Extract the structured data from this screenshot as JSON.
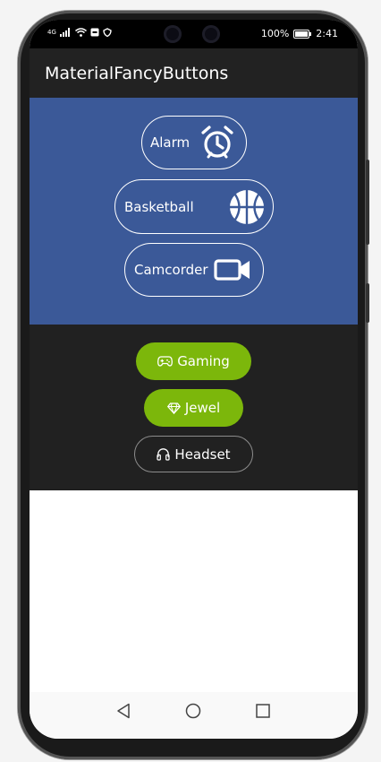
{
  "status_bar": {
    "signal_text": "4G",
    "battery": "100%",
    "time": "2:41"
  },
  "app_bar": {
    "title": "MaterialFancyButtons"
  },
  "fancy_buttons": [
    {
      "label": "Alarm",
      "icon": "alarm-clock-icon"
    },
    {
      "label": "Basketball",
      "icon": "basketball-icon"
    },
    {
      "label": "Camcorder",
      "icon": "video-camera-icon"
    }
  ],
  "pill_buttons": [
    {
      "label": "Gaming",
      "icon": "gamepad-icon",
      "style": "filled",
      "color": "#7cb70b"
    },
    {
      "label": "Jewel",
      "icon": "diamond-icon",
      "style": "filled",
      "color": "#7cb70b"
    },
    {
      "label": "Headset",
      "icon": "headphones-icon",
      "style": "outlined",
      "color": "#212121"
    }
  ],
  "colors": {
    "app_bar": "#222222",
    "blue_panel": "#3b5998",
    "dark_panel": "#212121",
    "accent_green": "#7cb70b"
  },
  "nav_bar": {
    "buttons": [
      "back-icon",
      "home-icon",
      "recents-icon"
    ]
  }
}
